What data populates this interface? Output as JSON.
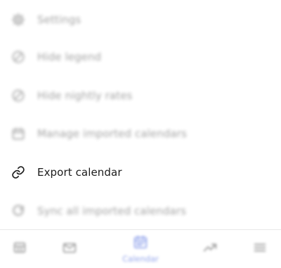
{
  "menu": {
    "items": [
      {
        "label": "Settings",
        "icon": "gear-icon"
      },
      {
        "label": "Hide legend",
        "icon": "circle-slash-icon"
      },
      {
        "label": "Hide nightly rates",
        "icon": "circle-slash-icon"
      },
      {
        "label": "Manage imported calendars",
        "icon": "calendar-icon"
      },
      {
        "label": "Export calendar",
        "icon": "link-icon"
      },
      {
        "label": "Sync all imported calendars",
        "icon": "refresh-icon"
      }
    ]
  },
  "tabbar": {
    "tabs": [
      {
        "icon": "reservations-icon",
        "label": ""
      },
      {
        "icon": "mail-icon",
        "label": ""
      },
      {
        "icon": "calendar-icon",
        "label": "Calendar",
        "selected": true
      },
      {
        "icon": "trending-up-icon",
        "label": ""
      },
      {
        "icon": "hamburger-menu-icon",
        "label": ""
      }
    ]
  },
  "colors": {
    "accent": "#3b5bdb",
    "active_text": "#1b1b1b",
    "dimmed_text": "#333333"
  }
}
